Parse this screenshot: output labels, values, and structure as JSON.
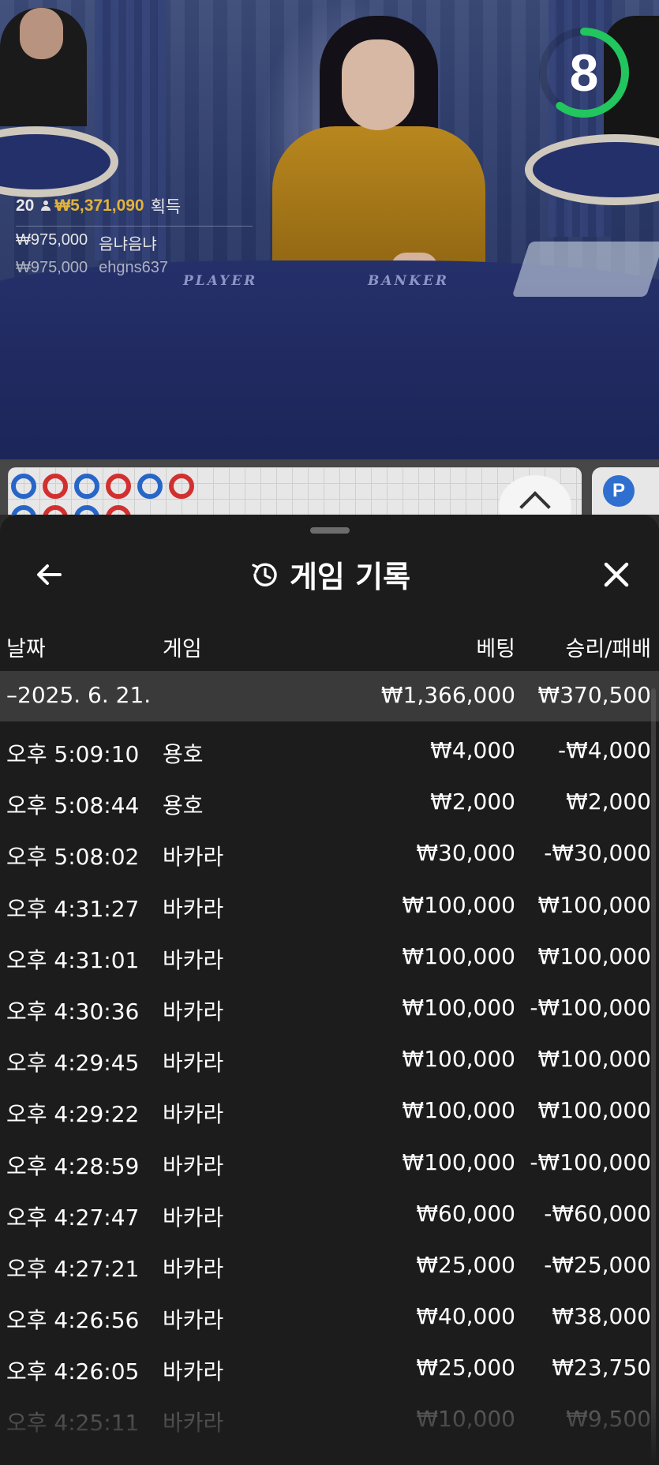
{
  "timer": {
    "value": "8",
    "ring_color": "#22c55e",
    "progress": 0.6
  },
  "table_labels": {
    "player": "PLAYER",
    "banker": "BANKER"
  },
  "winners": {
    "count": "20",
    "total": "₩5,371,090",
    "won_label": "획득",
    "entries": [
      {
        "amount": "₩975,000",
        "name": "음냐음냐"
      },
      {
        "amount": "₩975,000",
        "name": "ehgns637"
      }
    ]
  },
  "roadmap": {
    "p_label": "P"
  },
  "history": {
    "title": "게임 기록",
    "columns": {
      "date": "날짜",
      "game": "게임",
      "bet": "베팅",
      "result": "승리/패배"
    },
    "date_group": {
      "label": "–2025. 6. 21.",
      "bet_total": "₩1,366,000",
      "result_total": "₩370,500"
    },
    "rows": [
      {
        "time": "오후 5:09:10",
        "game": "용호",
        "bet": "₩4,000",
        "result": "-₩4,000"
      },
      {
        "time": "오후 5:08:44",
        "game": "용호",
        "bet": "₩2,000",
        "result": "₩2,000"
      },
      {
        "time": "오후 5:08:02",
        "game": "바카라",
        "bet": "₩30,000",
        "result": "-₩30,000"
      },
      {
        "time": "오후 4:31:27",
        "game": "바카라",
        "bet": "₩100,000",
        "result": "₩100,000"
      },
      {
        "time": "오후 4:31:01",
        "game": "바카라",
        "bet": "₩100,000",
        "result": "₩100,000"
      },
      {
        "time": "오후 4:30:36",
        "game": "바카라",
        "bet": "₩100,000",
        "result": "-₩100,000"
      },
      {
        "time": "오후 4:29:45",
        "game": "바카라",
        "bet": "₩100,000",
        "result": "₩100,000"
      },
      {
        "time": "오후 4:29:22",
        "game": "바카라",
        "bet": "₩100,000",
        "result": "₩100,000"
      },
      {
        "time": "오후 4:28:59",
        "game": "바카라",
        "bet": "₩100,000",
        "result": "-₩100,000"
      },
      {
        "time": "오후 4:27:47",
        "game": "바카라",
        "bet": "₩60,000",
        "result": "-₩60,000"
      },
      {
        "time": "오후 4:27:21",
        "game": "바카라",
        "bet": "₩25,000",
        "result": "-₩25,000"
      },
      {
        "time": "오후 4:26:56",
        "game": "바카라",
        "bet": "₩40,000",
        "result": "₩38,000"
      },
      {
        "time": "오후 4:26:05",
        "game": "바카라",
        "bet": "₩25,000",
        "result": "₩23,750"
      },
      {
        "time": "오후 4:25:11",
        "game": "바카라",
        "bet": "₩10,000",
        "result": "₩9,500"
      }
    ]
  },
  "icons": {
    "back": "arrow-left-icon",
    "close": "close-icon",
    "history": "history-clock-icon",
    "collapse": "chevron-up-icon"
  }
}
